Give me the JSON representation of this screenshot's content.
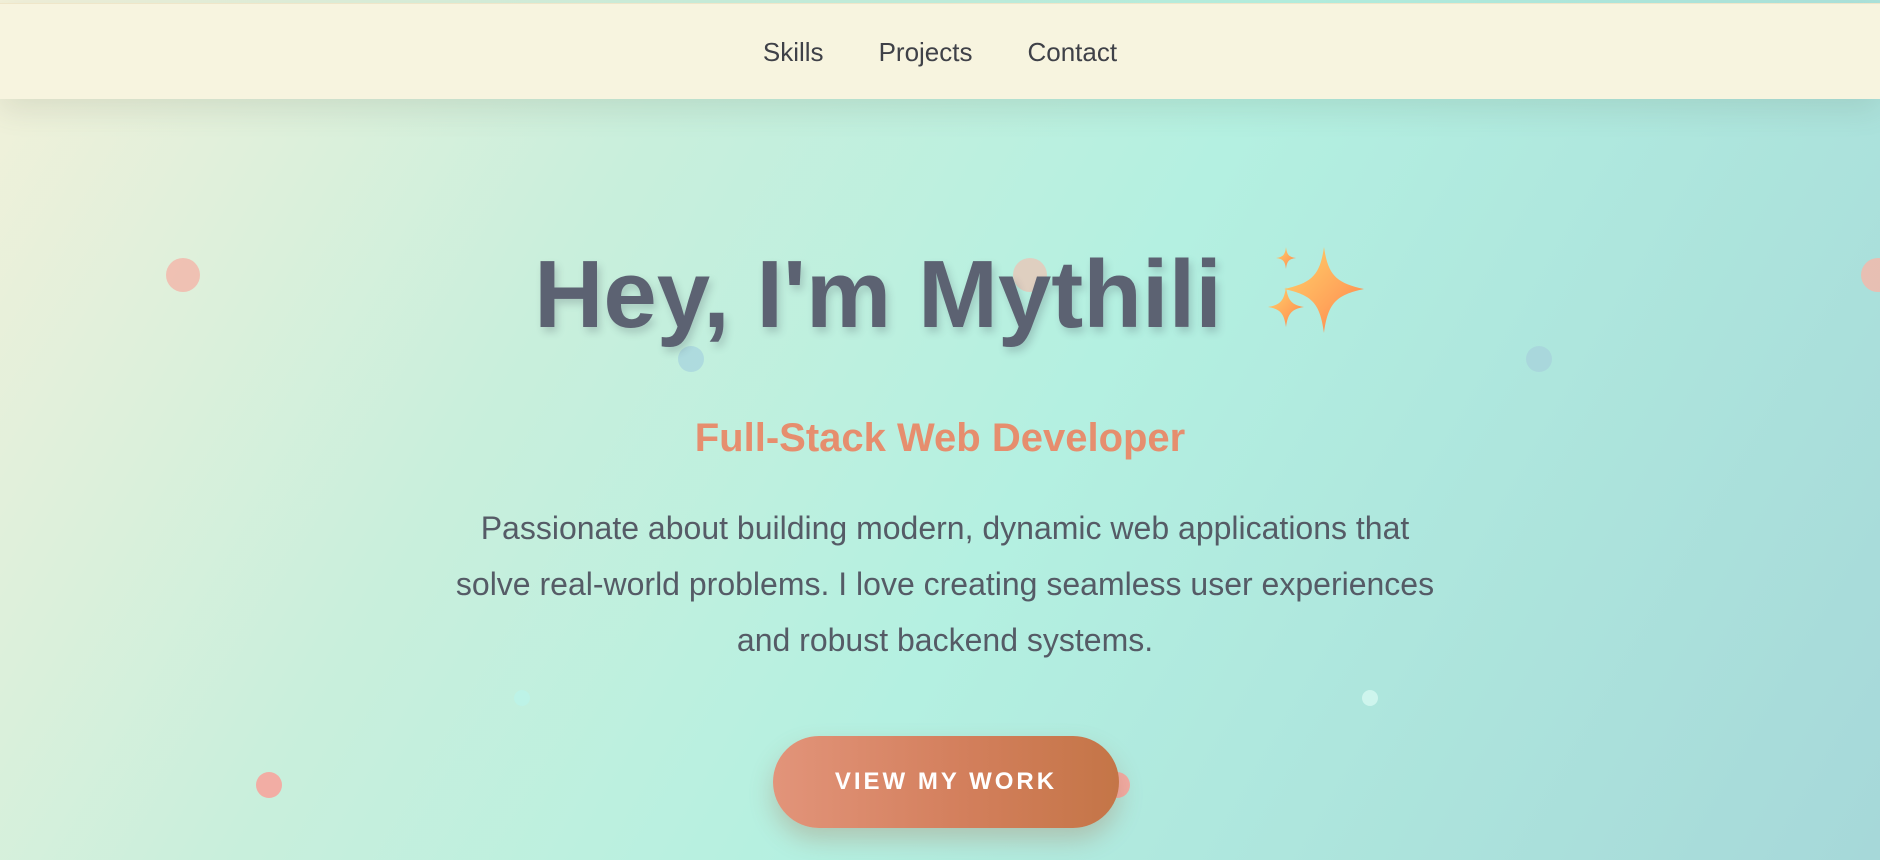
{
  "nav": {
    "items": [
      {
        "label": "Skills"
      },
      {
        "label": "Projects"
      },
      {
        "label": "Contact"
      }
    ]
  },
  "hero": {
    "title": "Hey, I'm Mythili",
    "title_icon": "sparkles-icon",
    "subtitle": "Full-Stack Web Developer",
    "description": "Passionate about building modern, dynamic web applications that solve real-world problems. I love creating seamless user experiences and robust backend systems.",
    "cta_label": "VIEW MY WORK"
  },
  "colors": {
    "nav_background": "#f7f4df",
    "title": "#5c6272",
    "subtitle_accent": "#e68e6e",
    "button_start": "#e2947a",
    "button_end": "#c47547",
    "background_light": "#f3f1da",
    "background_mint": "#b4f0e1"
  }
}
